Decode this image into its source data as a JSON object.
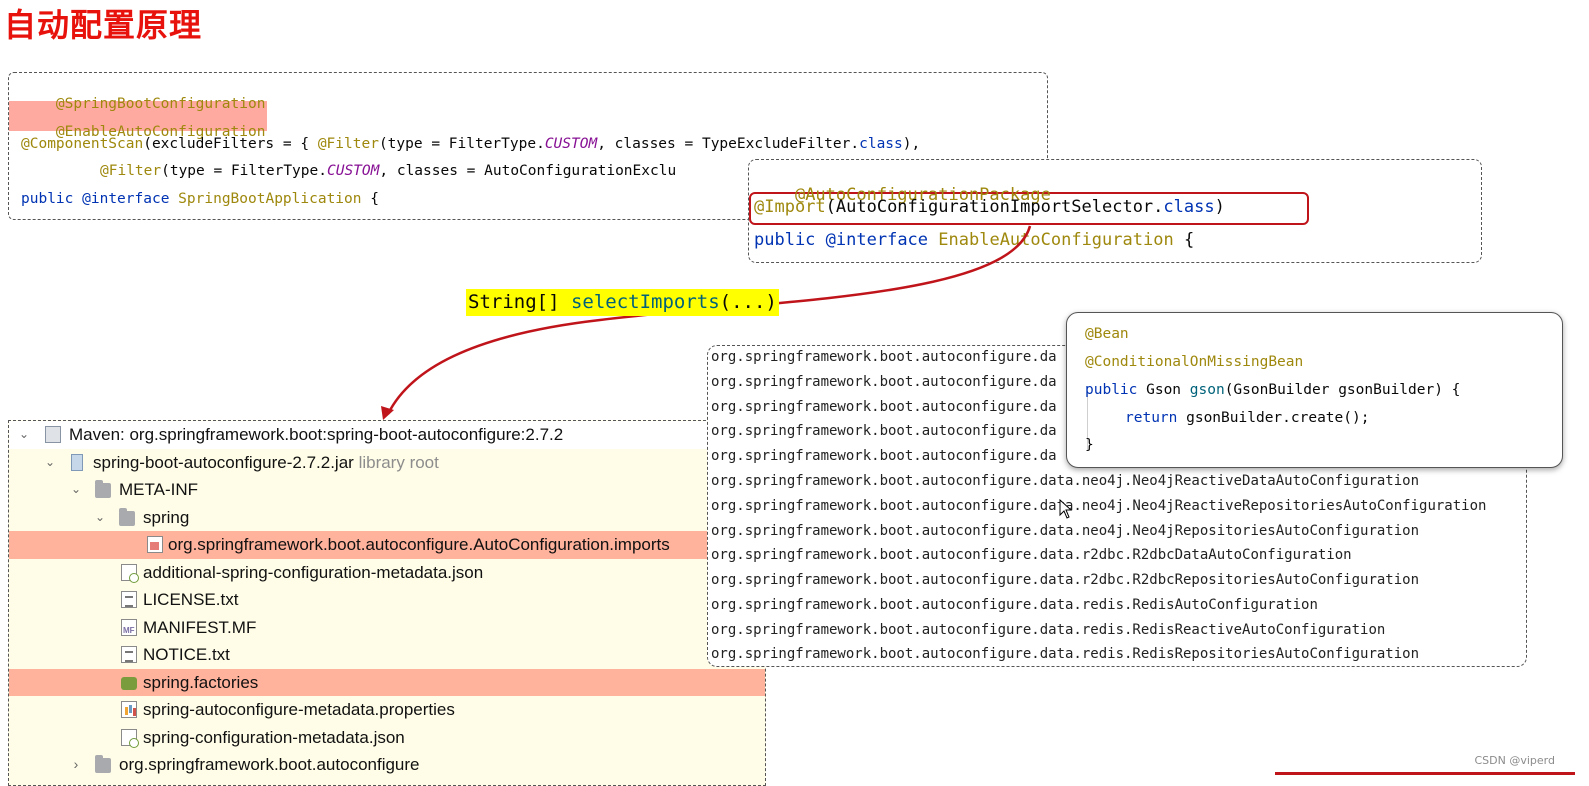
{
  "title": "自动配置原理",
  "spring_boot_app_code": {
    "line1": "@SpringBootConfiguration",
    "line2": "@EnableAutoConfiguration",
    "line3_ann": "@ComponentScan",
    "line3_a": "(excludeFilters = { ",
    "line3_filter": "@Filter",
    "line3_b": "(type = FilterType.",
    "line3_custom": "CUSTOM",
    "line3_c": ", classes = TypeExcludeFilter.",
    "line3_class": "class",
    "line3_d": "),",
    "line4_filter": "@Filter",
    "line4_a": "(type = FilterType.",
    "line4_custom": "CUSTOM",
    "line4_b": ", classes = AutoConfigurationExclu",
    "line5_public": "public",
    "line5_interface": "@interface",
    "line5_name": "SpringBootApplication",
    "line5_brace": "{"
  },
  "enable_auto_code": {
    "line1": "@AutoConfigurationPackage",
    "line2_ann": "@Import",
    "line2_a": "(AutoConfigurationImportSelector.",
    "line2_class": "class",
    "line2_b": ")",
    "line3_public": "public",
    "line3_interface": "@interface",
    "line3_name": "EnableAutoConfiguration",
    "line3_brace": "{"
  },
  "select_imports": {
    "type": "String[] ",
    "method": "selectImports",
    "args": "(...)"
  },
  "project_tree": [
    {
      "label": "Maven: org.springframework.boot:spring-boot-autoconfigure:2.7.2",
      "icon": "maven-library-icon",
      "expanded": true
    },
    {
      "label": "spring-boot-autoconfigure-2.7.2.jar",
      "suffix": "library root",
      "icon": "jar-icon",
      "expanded": true
    },
    {
      "label": "META-INF",
      "icon": "folder-icon",
      "expanded": true
    },
    {
      "label": "spring",
      "icon": "folder-icon",
      "expanded": true
    },
    {
      "label": "org.springframework.boot.autoconfigure.AutoConfiguration.imports",
      "icon": "imports-file-icon",
      "highlighted": true
    },
    {
      "label": "additional-spring-configuration-metadata.json",
      "icon": "json-file-icon"
    },
    {
      "label": "LICENSE.txt",
      "icon": "text-file-icon"
    },
    {
      "label": "MANIFEST.MF",
      "icon": "manifest-file-icon"
    },
    {
      "label": "NOTICE.txt",
      "icon": "text-file-icon"
    },
    {
      "label": "spring.factories",
      "icon": "spring-factories-icon",
      "highlighted": true
    },
    {
      "label": "spring-autoconfigure-metadata.properties",
      "icon": "properties-file-icon"
    },
    {
      "label": "spring-configuration-metadata.json",
      "icon": "json-file-icon"
    },
    {
      "label": "org.springframework.boot.autoconfigure",
      "icon": "folder-icon",
      "expanded": false
    }
  ],
  "imports_list": [
    "org.springframework.boot.autoconfigure.da",
    "org.springframework.boot.autoconfigure.da",
    "org.springframework.boot.autoconfigure.da",
    "org.springframework.boot.autoconfigure.da",
    "org.springframework.boot.autoconfigure.da",
    "org.springframework.boot.autoconfigure.data.neo4j.Neo4jReactiveDataAutoConfiguration",
    "org.springframework.boot.autoconfigure.data.neo4j.Neo4jReactiveRepositoriesAutoConfiguration",
    "org.springframework.boot.autoconfigure.data.neo4j.Neo4jRepositoriesAutoConfiguration",
    "org.springframework.boot.autoconfigure.data.r2dbc.R2dbcDataAutoConfiguration",
    "org.springframework.boot.autoconfigure.data.r2dbc.R2dbcRepositoriesAutoConfiguration",
    "org.springframework.boot.autoconfigure.data.redis.RedisAutoConfiguration",
    "org.springframework.boot.autoconfigure.data.redis.RedisReactiveAutoConfiguration",
    "org.springframework.boot.autoconfigure.data.redis.RedisRepositoriesAutoConfiguration"
  ],
  "gson_code": {
    "line1": "@Bean",
    "line2": "@ConditionalOnMissingBean",
    "line3_public": "public",
    "line3_a": " Gson ",
    "line3_method": "gson",
    "line3_b": "(GsonBuilder gsonBuilder) {",
    "line4_return": "return",
    "line4_a": " gsonBuilder.create();",
    "line5": "}"
  },
  "watermark": "CSDN @viperd",
  "colors": {
    "title": "#e8120c",
    "annotation": "#9e880d",
    "keyword": "#0033b3",
    "highlight_row": "#ffb29c",
    "import_outline": "#c0141b",
    "arrow": "#c0141b",
    "select_label_bg": "#ffff00"
  }
}
